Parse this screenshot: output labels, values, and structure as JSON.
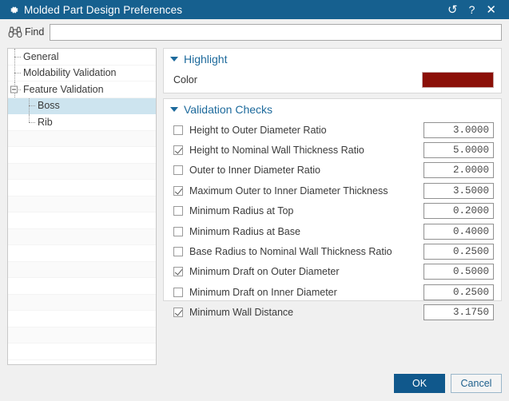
{
  "window": {
    "title": "Molded Part Design Preferences",
    "gear_icon": "gear-icon",
    "actions": [
      {
        "name": "reset-button",
        "glyph": "↺"
      },
      {
        "name": "help-button",
        "glyph": "?"
      },
      {
        "name": "close-button",
        "glyph": "✕"
      }
    ]
  },
  "find": {
    "icon": "binoculars-icon",
    "label": "Find",
    "value": "",
    "placeholder": ""
  },
  "tree": {
    "items": [
      {
        "label": "General",
        "level": 1,
        "selected": false,
        "expandable": false
      },
      {
        "label": "Moldability Validation",
        "level": 1,
        "selected": false,
        "expandable": false
      },
      {
        "label": "Feature Validation",
        "level": 1,
        "selected": false,
        "expandable": true
      },
      {
        "label": "Boss",
        "level": 2,
        "selected": true,
        "expandable": false
      },
      {
        "label": "Rib",
        "level": 2,
        "selected": false,
        "expandable": false
      }
    ],
    "empty_rows": 14
  },
  "highlight": {
    "title": "Highlight",
    "color_label": "Color",
    "color_value": "#8b1008"
  },
  "validation": {
    "title": "Validation Checks",
    "checks": [
      {
        "label": "Height to Outer Diameter Ratio",
        "checked": false,
        "value": "3.0000"
      },
      {
        "label": "Height to Nominal Wall Thickness Ratio",
        "checked": true,
        "value": "5.0000"
      },
      {
        "label": "Outer to Inner Diameter Ratio",
        "checked": false,
        "value": "2.0000"
      },
      {
        "label": "Maximum Outer to Inner Diameter Thickness",
        "checked": true,
        "value": "3.5000"
      },
      {
        "label": "Minimum Radius at Top",
        "checked": false,
        "value": "0.2000"
      },
      {
        "label": "Minimum Radius at Base",
        "checked": false,
        "value": "0.4000"
      },
      {
        "label": "Base Radius to Nominal Wall Thickness Ratio",
        "checked": false,
        "value": "0.2500"
      },
      {
        "label": "Minimum Draft on Outer Diameter",
        "checked": true,
        "value": "0.5000"
      },
      {
        "label": "Minimum Draft on Inner Diameter",
        "checked": false,
        "value": "0.2500"
      },
      {
        "label": "Minimum Wall Distance",
        "checked": true,
        "value": "3.1750"
      }
    ]
  },
  "footer": {
    "ok_label": "OK",
    "cancel_label": "Cancel"
  },
  "colors": {
    "titlebar": "#16608f",
    "accent": "#1d6a9c",
    "selection": "#cde4ef",
    "highlight_color": "#8b1008",
    "ok_button": "#10588c"
  }
}
